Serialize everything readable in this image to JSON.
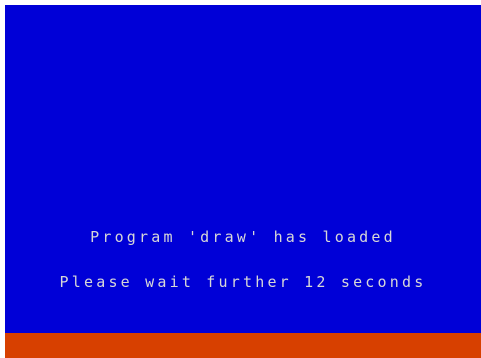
{
  "screen": {
    "line1": "Program 'draw' has loaded",
    "line2": "Please wait further 12 seconds"
  },
  "colors": {
    "paper": "#0000d7",
    "border": "#d74000",
    "ink": "#d7d7d7"
  }
}
